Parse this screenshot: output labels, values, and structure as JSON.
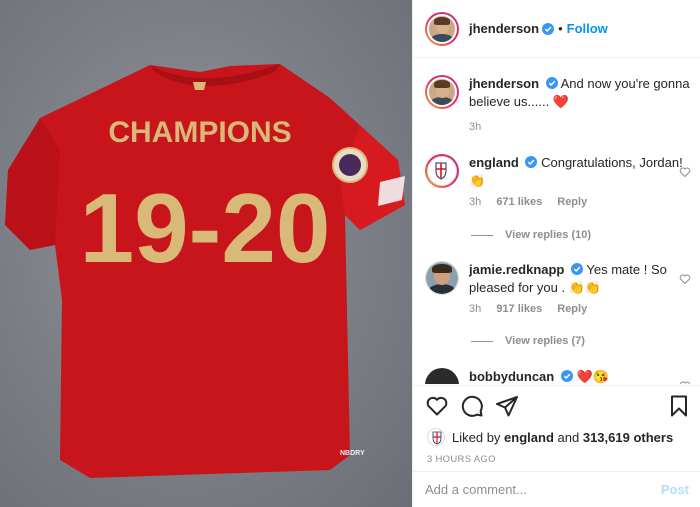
{
  "post": {
    "author": "jhenderson",
    "follow_label": "Follow",
    "separator": "•",
    "photo_text": {
      "name": "CHAMPIONS",
      "number": "19-20",
      "brand": "NBDRY"
    }
  },
  "comments": [
    {
      "user": "jhenderson",
      "text": "And now you're gonna believe us...... ❤️",
      "time": "3h"
    },
    {
      "user": "england",
      "text": "Congratulations, Jordan! 👏",
      "time": "3h",
      "likes": "671 likes",
      "reply_label": "Reply",
      "view_replies": "View replies (10)"
    },
    {
      "user": "jamie.redknapp",
      "text": "Yes mate ! So pleased for you . 👏👏",
      "time": "3h",
      "likes": "917 likes",
      "reply_label": "Reply",
      "view_replies": "View replies (7)"
    },
    {
      "user": "bobbyduncan",
      "text": "❤️😘"
    }
  ],
  "likes": {
    "prefix": "Liked by",
    "user": "england",
    "mid": "and",
    "count": "313,619 others"
  },
  "posted_ago": "3 HOURS AGO",
  "comment_input": {
    "placeholder": "Add a comment...",
    "post_label": "Post"
  },
  "colors": {
    "accent": "#0095f6",
    "jersey": "#d4141c",
    "gold": "#d9b978"
  },
  "icons": [
    "verified-icon",
    "heart-icon",
    "comment-icon",
    "share-icon",
    "bookmark-icon"
  ]
}
